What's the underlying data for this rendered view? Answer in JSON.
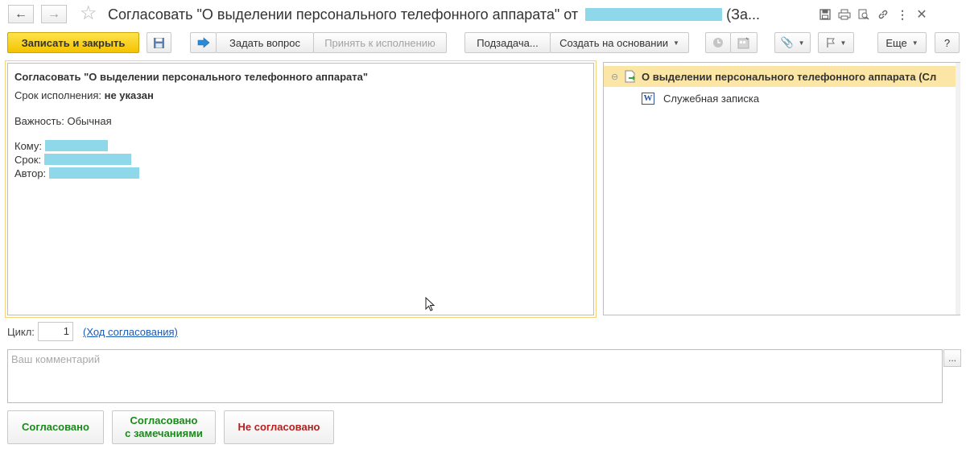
{
  "window": {
    "title_prefix": "Согласовать \"О выделении персонального телефонного аппарата\" от",
    "title_suffix": "(За..."
  },
  "toolbar": {
    "save_close_label": "Записать и закрыть",
    "ask_question_label": "Задать вопрос",
    "accept_label": "Принять к исполнению",
    "subtask_label": "Подзадача...",
    "create_based_label": "Создать на основании",
    "more_label": "Еще",
    "help_label": "?"
  },
  "task": {
    "heading": "Согласовать \"О выделении персонального телефонного аппарата\"",
    "deadline_label": "Срок исполнения:",
    "deadline_value": "не указан",
    "importance_label": "Важность:",
    "importance_value": "Обычная",
    "to_label": "Кому:",
    "due_label": "Срок:",
    "author_label": "Автор:"
  },
  "tree": {
    "root_label": "О выделении персонального телефонного аппарата (Сл",
    "child_label": "Служебная записка"
  },
  "bottom": {
    "cycle_label": "Цикл:",
    "cycle_value": "1",
    "progress_link": "(Ход согласования)",
    "comment_placeholder": "Ваш комментарий",
    "more_button": "..."
  },
  "decisions": {
    "approved": "Согласовано",
    "approved_remarks_line1": "Согласовано",
    "approved_remarks_line2": "с замечаниями",
    "not_approved": "Не согласовано"
  },
  "colors": {
    "primary_button": "#f4c300",
    "selected_row": "#fbe6a6",
    "link": "#1a5bb8",
    "approve_text": "#198a19",
    "reject_text": "#b52020",
    "redaction": "#8fd8ea"
  },
  "icons": {
    "back": "arrow-left",
    "forward": "arrow-right",
    "favorite": "star",
    "save": "floppy-disk",
    "print": "printer",
    "search": "magnifier",
    "link": "chain-link",
    "menu": "vertical-dots",
    "close": "x"
  }
}
